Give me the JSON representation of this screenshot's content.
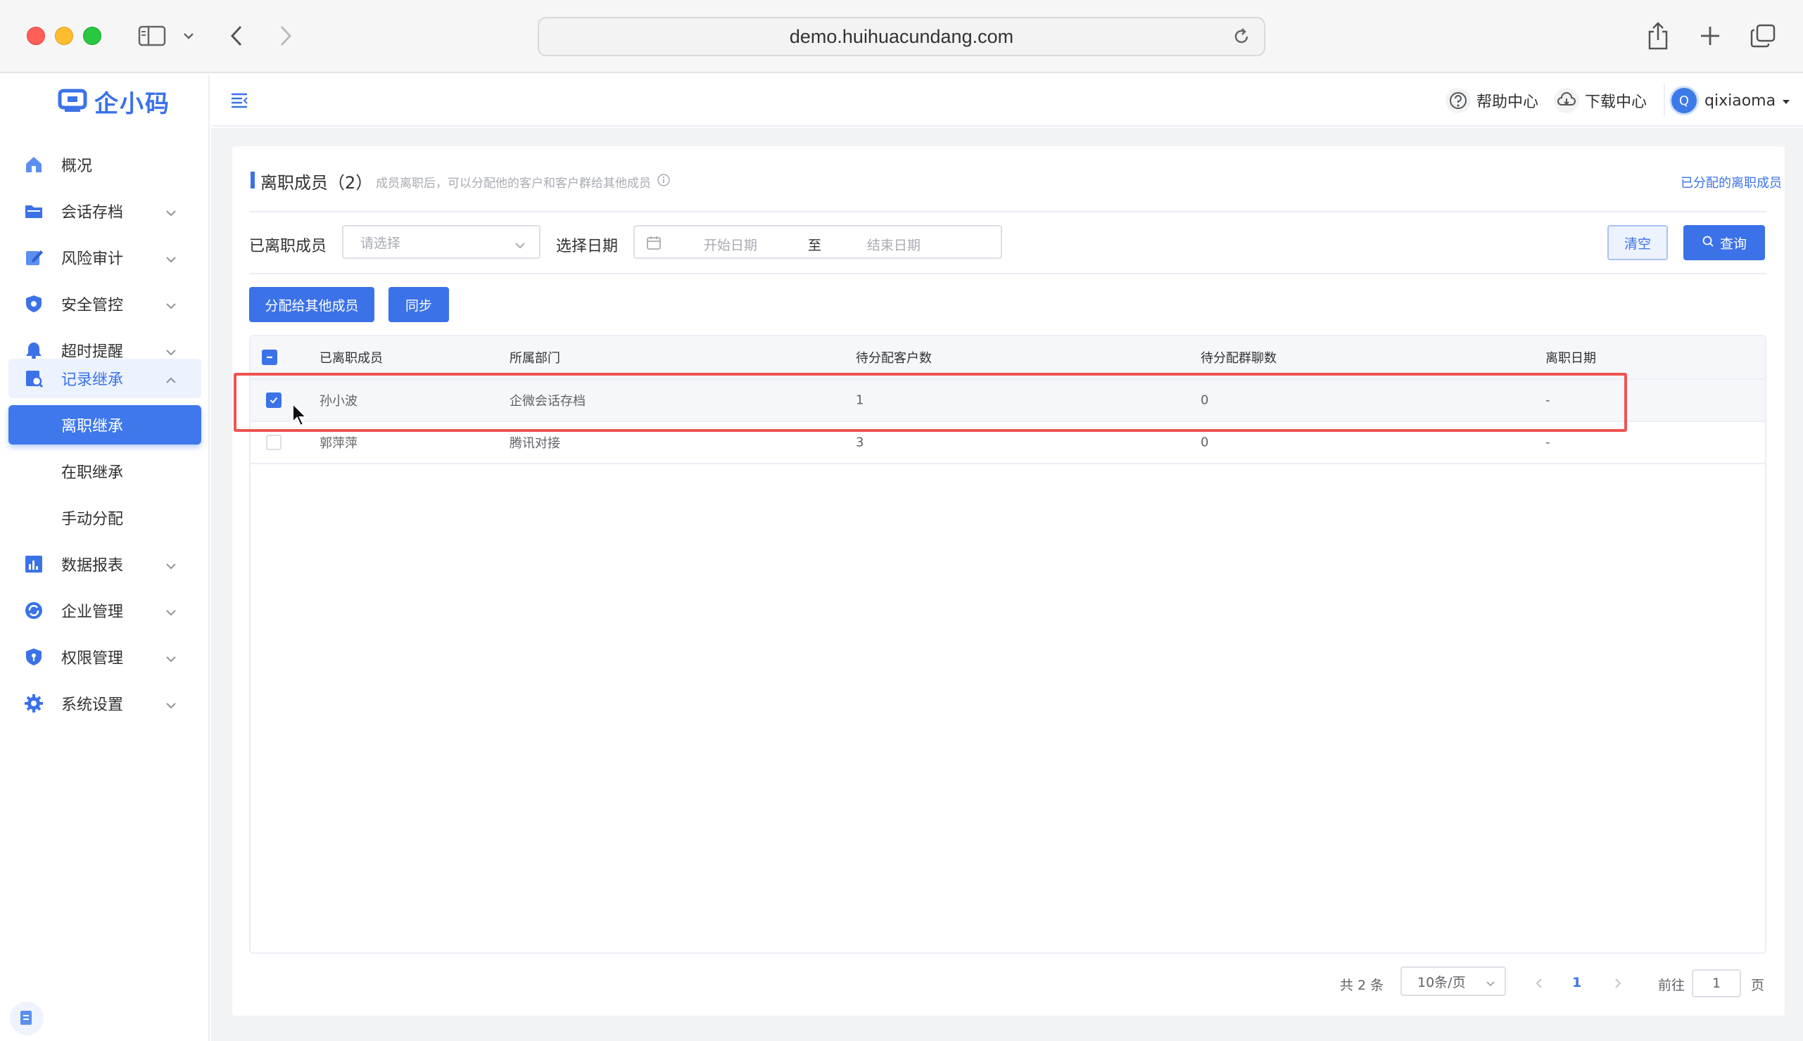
{
  "browser": {
    "url": "demo.huihuacundang.com"
  },
  "sidebar": {
    "logo_text": "企小码",
    "items": [
      {
        "label": "概况",
        "icon": "home-icon"
      },
      {
        "label": "会话存档",
        "icon": "folder-icon"
      },
      {
        "label": "风险审计",
        "icon": "edit-icon"
      },
      {
        "label": "安全管控",
        "icon": "shield-icon"
      },
      {
        "label": "超时提醒",
        "icon": "bell-icon"
      },
      {
        "label": "记录继承",
        "icon": "record-icon"
      },
      {
        "label": "数据报表",
        "icon": "bar-chart-icon"
      },
      {
        "label": "企业管理",
        "icon": "refresh-icon"
      },
      {
        "label": "权限管理",
        "icon": "lock-shield-icon"
      },
      {
        "label": "系统设置",
        "icon": "gear-icon"
      }
    ],
    "subitems": [
      {
        "label": "离职继承"
      },
      {
        "label": "在职继承"
      },
      {
        "label": "手动分配"
      }
    ]
  },
  "header": {
    "help": "帮助中心",
    "download": "下载中心",
    "avatar_letter": "Q",
    "username": "qixiaoma"
  },
  "page": {
    "title": "离职成员",
    "count": "（2）",
    "hint": "成员离职后，可以分配他的客户和客户群给其他成员",
    "assigned_link": "已分配的离职成员"
  },
  "filters": {
    "member_label": "已离职成员",
    "member_placeholder": "请选择",
    "date_label": "选择日期",
    "date_start": "开始日期",
    "date_sep": "至",
    "date_end": "结束日期",
    "clear_label": "清空",
    "query_label": "查询"
  },
  "actions": {
    "assign_label": "分配给其他成员",
    "sync_label": "同步"
  },
  "table": {
    "columns": [
      "已离职成员",
      "所属部门",
      "待分配客户数",
      "待分配群聊数",
      "离职日期"
    ],
    "rows": [
      {
        "name": "孙小波",
        "dept": "企微会话存档",
        "customers": "1",
        "groups": "0",
        "date": "-",
        "checked": true
      },
      {
        "name": "郭萍萍",
        "dept": "腾讯对接",
        "customers": "3",
        "groups": "0",
        "date": "-",
        "checked": false
      }
    ]
  },
  "pagination": {
    "total": "共 2 条",
    "page_size": "10条/页",
    "current": "1",
    "goto_label": "前往",
    "goto_value": "1",
    "page_suffix": "页"
  },
  "colors": {
    "accent": "#3b72e8",
    "highlight": "#ef5350"
  }
}
